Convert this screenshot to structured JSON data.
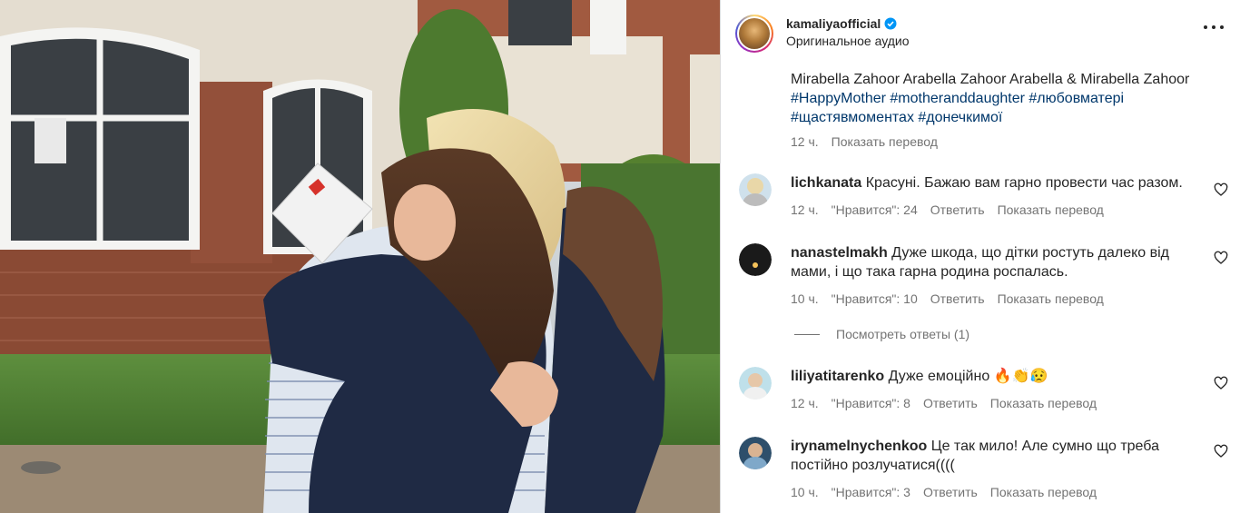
{
  "header": {
    "username": "kamaliyaofficial",
    "subtitle": "Оригинальное аудио",
    "more_icon": "more-horizontal-icon",
    "verified_color": "#0095f6"
  },
  "caption": {
    "line1": "Mirabella Zahoor Arabella Zahoor Arabella & Mirabella Zahoor",
    "tags_line2": "#HappyMother #motheranddaughter #любовматері",
    "tags_line3": "#щастявмоментах #донечкимої",
    "time": "12 ч.",
    "translate": "Показать перевод"
  },
  "comments": [
    {
      "user": "lichkanata",
      "text": "Красуні. Бажаю вам гарно провести час разом.",
      "time": "12 ч.",
      "likes": "\"Нравится\": 24",
      "reply": "Ответить",
      "translate": "Показать перевод"
    },
    {
      "user": "nanastelmakh",
      "text": "Дуже шкода, що дітки ростуть далеко від мами, і що така гарна родина роспалась.",
      "time": "10 ч.",
      "likes": "\"Нравится\": 10",
      "reply": "Ответить",
      "translate": "Показать перевод"
    },
    {
      "user": "liliyatitarenko",
      "text": "Дуже емоційно 🔥👏😥",
      "time": "12 ч.",
      "likes": "\"Нравится\": 8",
      "reply": "Ответить",
      "translate": "Показать перевод"
    },
    {
      "user": "irynamelnychenkoo",
      "text": "Це так мило! Але сумно що треба постійно розлучатися((((",
      "time": "10 ч.",
      "likes": "\"Нравится\": 3",
      "reply": "Ответить",
      "translate": "Показать перевод"
    }
  ],
  "view_replies": "Посмотреть ответы (1)",
  "heart_icon": "heart-outline-icon"
}
